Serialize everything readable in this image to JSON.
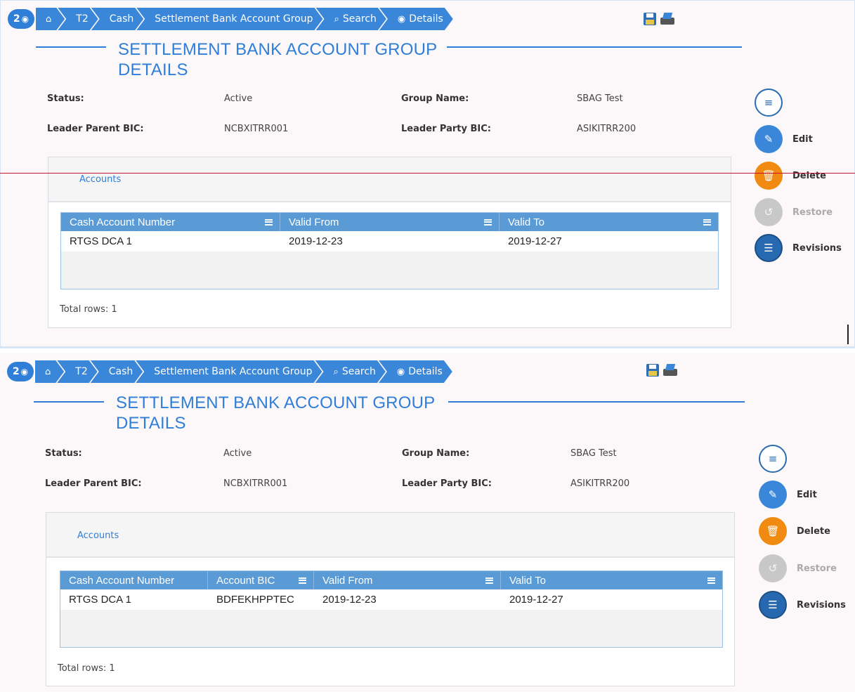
{
  "screens": [
    {
      "counter": "2",
      "breadcrumb": [
        {
          "label": "",
          "icon": "home-icon"
        },
        {
          "label": "T2"
        },
        {
          "label": "Cash"
        },
        {
          "label": "Settlement Bank Account Group"
        },
        {
          "label": "Search",
          "icon": "search-icon"
        },
        {
          "label": "Details",
          "icon": "eye-icon"
        }
      ],
      "title_line1": "SETTLEMENT BANK ACCOUNT GROUP",
      "title_line2": "DETAILS",
      "fields": {
        "status_label": "Status:",
        "status_value": "Active",
        "group_name_label": "Group Name:",
        "group_name_value": "SBAG Test",
        "leader_parent_bic_label": "Leader Parent BIC:",
        "leader_parent_bic_value": "NCBXITRR001",
        "leader_party_bic_label": "Leader Party BIC:",
        "leader_party_bic_value": "ASIKITRR200"
      },
      "accounts_tab": "Accounts",
      "columns": [
        "Cash Account Number",
        "Valid From",
        "Valid To"
      ],
      "rows": [
        [
          "RTGS DCA 1",
          "2019-12-23",
          "2019-12-27"
        ]
      ],
      "total_rows": "Total rows: 1",
      "actions": {
        "edit": "Edit",
        "delete": "Delete",
        "restore": "Restore",
        "revisions": "Revisions"
      }
    },
    {
      "counter": "2",
      "breadcrumb": [
        {
          "label": "",
          "icon": "home-icon"
        },
        {
          "label": "T2"
        },
        {
          "label": "Cash"
        },
        {
          "label": "Settlement Bank Account Group"
        },
        {
          "label": "Search",
          "icon": "search-icon"
        },
        {
          "label": "Details",
          "icon": "eye-icon"
        }
      ],
      "title_line1": "SETTLEMENT BANK ACCOUNT GROUP",
      "title_line2": "DETAILS",
      "fields": {
        "status_label": "Status:",
        "status_value": "Active",
        "group_name_label": "Group Name:",
        "group_name_value": "SBAG Test",
        "leader_parent_bic_label": "Leader Parent BIC:",
        "leader_parent_bic_value": "NCBXITRR001",
        "leader_party_bic_label": "Leader Party BIC:",
        "leader_party_bic_value": "ASIKITRR200"
      },
      "accounts_tab": "Accounts",
      "columns": [
        "Cash Account Number",
        "Account BIC",
        "Valid From",
        "Valid To"
      ],
      "rows": [
        [
          "RTGS DCA 1",
          "BDFEKHPPTEC",
          "2019-12-23",
          "2019-12-27"
        ]
      ],
      "total_rows": "Total rows: 1",
      "actions": {
        "edit": "Edit",
        "delete": "Delete",
        "restore": "Restore",
        "revisions": "Revisions"
      }
    }
  ],
  "colors": {
    "primary": "#3a86d9",
    "delete": "#f08a10",
    "disabled": "#c8c8c8",
    "grid_header": "#5b9bd5",
    "annotation_line": "#c0162f"
  }
}
